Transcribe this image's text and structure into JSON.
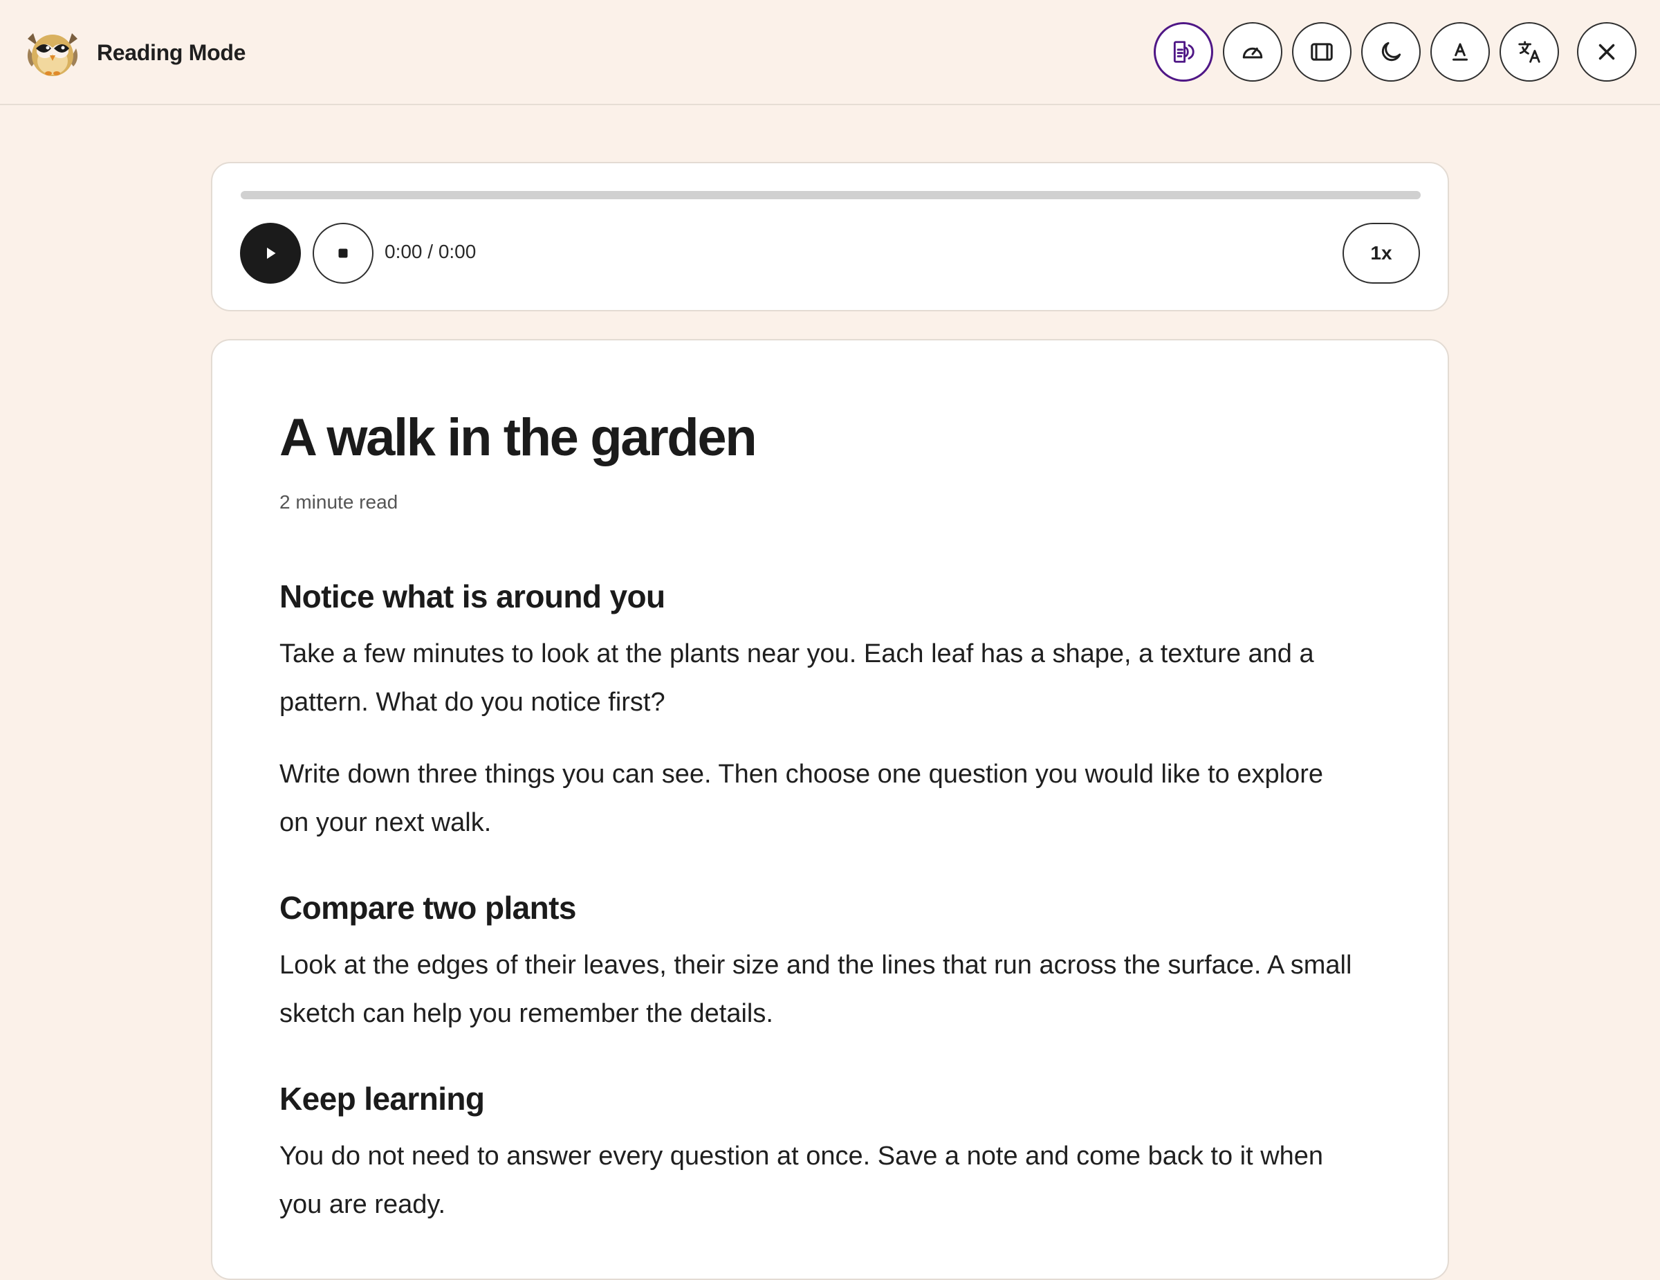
{
  "header": {
    "app_title": "Reading Mode",
    "logo_icon": "owl-logo-icon",
    "tools": [
      {
        "name": "read-aloud-button",
        "icon": "read-aloud-icon",
        "active": true
      },
      {
        "name": "reading-speed-button",
        "icon": "speedometer-icon",
        "active": false
      },
      {
        "name": "focus-view-button",
        "icon": "panel-icon",
        "active": false
      },
      {
        "name": "dark-mode-button",
        "icon": "moon-icon",
        "active": false
      },
      {
        "name": "text-style-button",
        "icon": "text-format-icon",
        "active": false
      },
      {
        "name": "translate-button",
        "icon": "translate-icon",
        "active": false
      }
    ],
    "close_icon": "close-icon"
  },
  "player": {
    "progress": 0,
    "time": "0:00 / 0:00",
    "speed": "1x",
    "play_icon": "play-icon",
    "stop_icon": "stop-icon"
  },
  "article": {
    "title": "A walk in the garden",
    "read_time": "2 minute read",
    "sections": [
      {
        "heading": "Notice what is around you",
        "paragraphs": [
          "Take a few minutes to look at the plants near you. Each leaf has a shape, a texture and a pattern. What do you notice first?",
          "Write down three things you can see. Then choose one question you would like to explore on your next walk."
        ]
      },
      {
        "heading": "Compare two plants",
        "paragraphs": [
          "Look at the edges of their leaves, their size and the lines that run across the surface. A small sketch can help you remember the details."
        ]
      },
      {
        "heading": "Keep learning",
        "paragraphs": [
          "You do not need to answer every question at once. Save a note and come back to it when you are ready."
        ]
      }
    ]
  },
  "colors": {
    "background": "#fbf1e9",
    "accent": "#4f1786",
    "card": "#ffffff",
    "text": "#1c1c1c"
  }
}
